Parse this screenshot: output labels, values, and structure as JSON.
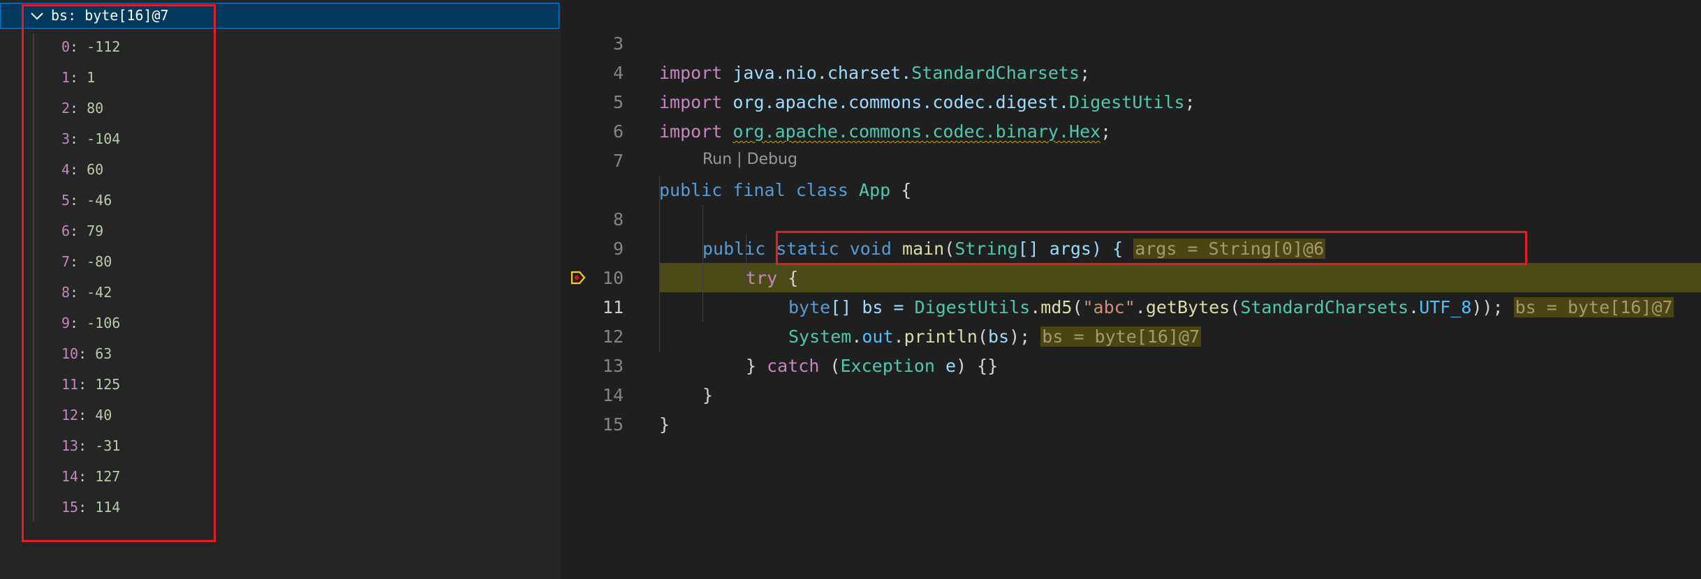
{
  "variables": {
    "header": {
      "name": "bs",
      "separator": ": ",
      "value": "byte[16]@7"
    },
    "items": [
      {
        "key": "0",
        "value": "-112"
      },
      {
        "key": "1",
        "value": "1"
      },
      {
        "key": "2",
        "value": "80"
      },
      {
        "key": "3",
        "value": "-104"
      },
      {
        "key": "4",
        "value": "60"
      },
      {
        "key": "5",
        "value": "-46"
      },
      {
        "key": "6",
        "value": "79"
      },
      {
        "key": "7",
        "value": "-80"
      },
      {
        "key": "8",
        "value": "-42"
      },
      {
        "key": "9",
        "value": "-106"
      },
      {
        "key": "10",
        "value": "63"
      },
      {
        "key": "11",
        "value": "125"
      },
      {
        "key": "12",
        "value": "40"
      },
      {
        "key": "13",
        "value": "-31"
      },
      {
        "key": "14",
        "value": "127"
      },
      {
        "key": "15",
        "value": "114"
      }
    ]
  },
  "editor": {
    "line_numbers": [
      "3",
      "4",
      "5",
      "6",
      "7",
      "8",
      "9",
      "10",
      "11",
      "12",
      "13",
      "14",
      "15"
    ],
    "codelens": {
      "run": "Run",
      "sep": " | ",
      "debug": "Debug"
    },
    "inline_values": {
      "args": "args = String[0]@6",
      "bs_line10": "bs = byte[16]@7",
      "bs_line11": "bs = byte[16]@7"
    },
    "tokens": {
      "import": "import",
      "pkg_java": "java.nio.charset.",
      "cls_charsets": "StandardCharsets",
      "pkg_codec_digest": "org.apache.commons.codec.digest.",
      "cls_digestutils": "DigestUtils",
      "pkg_codec_binary": "org.apache.commons.codec.binary.Hex",
      "semi": ";",
      "public": "public",
      "final": "final",
      "class": "class",
      "cls_app": "App",
      "brace_open": " {",
      "static": "static",
      "void": "void",
      "main": "main",
      "string_type": "String",
      "args_sig": "[] args) {",
      "try": "try",
      "byte": "byte",
      "bs_decl": "[] bs = ",
      "md5": "md5",
      "abc": "\"abc\"",
      "getbytes": "getBytes",
      "utf8": "UTF_8",
      "close_call": "));",
      "system": "System",
      "out": "out",
      "println": "println",
      "bs": "bs",
      "close_println": ");",
      "catch_open": "} ",
      "catch": "catch",
      "exception": "Exception",
      "e_var": "e",
      "catch_close": ") {}",
      "brace_close": "}"
    }
  },
  "colors": {
    "accent_red_box": "#e51c23",
    "selection": "#04395e",
    "debug_line": "#4b4b18",
    "breakpoint": "#ffcc00"
  }
}
